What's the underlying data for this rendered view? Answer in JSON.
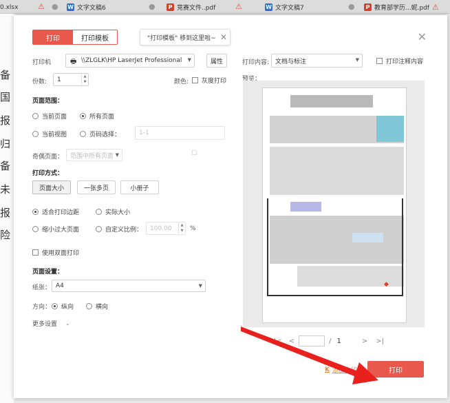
{
  "tabs": [
    {
      "label": "0.xlsx",
      "type": "x"
    },
    {
      "label": "文字文稿6",
      "type": "w"
    },
    {
      "label": "竞赛文件..pdf",
      "type": "p"
    },
    {
      "label": "文字文稿7",
      "type": "w"
    },
    {
      "label": "教育部学历...妮.pdf",
      "type": "p"
    }
  ],
  "left_doc_chars": [
    "备",
    "国",
    "报",
    "归",
    "备",
    "未",
    "报",
    "险"
  ],
  "dialog": {
    "tab_print": "打印",
    "tab_template": "打印模板",
    "tip_text": "\"打印模板\" 移到这里啦~",
    "printer_label": "打印机",
    "printer_value": "\\\\ZLGLK\\HP LaserJet Professional",
    "properties_button": "属性",
    "copies_label": "份数:",
    "copies_value": "1",
    "color_label": "颜色:",
    "grayscale_label": "灰度打印",
    "print_content_label": "打印内容:",
    "print_content_value": "文档与标注",
    "print_comments_label": "打印注释内容",
    "preview_label": "预览：",
    "page_range_title": "页面范围：",
    "current_page": "当前页面",
    "all_pages": "所有页面",
    "current_view": "当前视图",
    "page_select": "页码选择：",
    "page_select_placeholder": "1-1",
    "odd_even_label": "奇偶页面：",
    "odd_even_value": "范围中所有页面",
    "print_mode_title": "打印方式：",
    "mode_page_size": "页面大小",
    "mode_multi": "一张多页",
    "mode_booklet": "小册子",
    "fit_margin": "适合打印边距",
    "actual_size": "实际大小",
    "shrink_large": "缩小过大页面",
    "custom_scale": "自定义比例：",
    "scale_value": "100.00",
    "scale_unit": "%",
    "duplex": "使用双面打印",
    "page_setup_title": "页面设置：",
    "paper_label": "纸张：",
    "paper_value": "A4",
    "orientation_label": "方向：",
    "portrait": "纵向",
    "landscape": "横向",
    "more_settings": "更多设置",
    "page_total": "1",
    "page_sep": "/",
    "watermark_link": "添加水印",
    "print_button": "打印"
  },
  "colors": {
    "accent": "#e8584c",
    "link": "#e0843a"
  }
}
